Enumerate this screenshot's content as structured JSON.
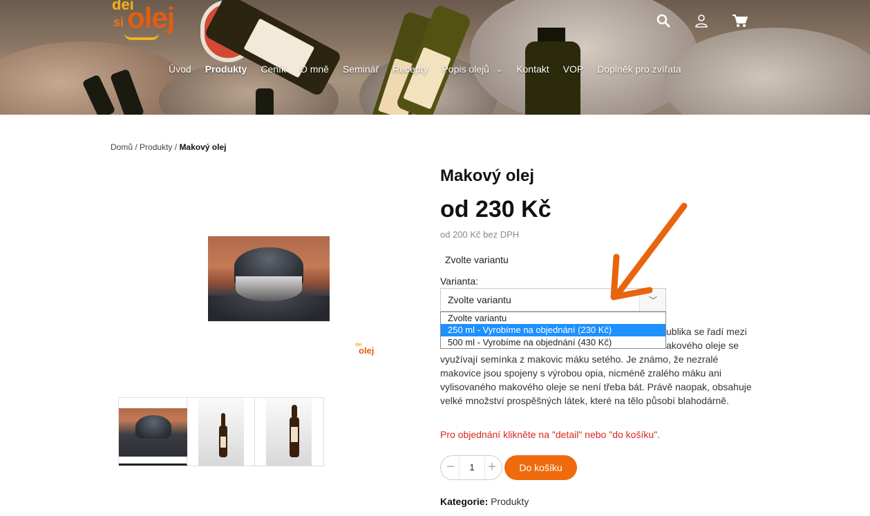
{
  "brand": {
    "logo_text_top": "dei",
    "logo_text_small": "si",
    "logo_text_main": "olej"
  },
  "header": {
    "nav": [
      {
        "label": "Úvod",
        "active": false
      },
      {
        "label": "Produkty",
        "active": true
      },
      {
        "label": "Ceník",
        "active": false
      },
      {
        "label": "O mně",
        "active": false
      },
      {
        "label": "Seminář",
        "active": false
      },
      {
        "label": "Recepty",
        "active": false
      },
      {
        "label": "Popis olejů",
        "active": false,
        "has_dropdown": true
      },
      {
        "label": "Kontakt",
        "active": false
      },
      {
        "label": "VOP",
        "active": false
      },
      {
        "label": "Doplněk pro zvířata",
        "active": false
      }
    ],
    "icons": [
      "search-icon",
      "user-icon",
      "cart-icon"
    ]
  },
  "breadcrumb": {
    "home": "Domů",
    "sep": "/",
    "section": "Produkty",
    "current": "Makový olej"
  },
  "product": {
    "title": "Makový olej",
    "price": "od 230 Kč",
    "price_net": "od 200 Kč bez DPH",
    "choose_variant": "Zvolte variantu",
    "variant_label": "Varianta:",
    "select_value": "Zvolte variantu",
    "options": [
      "Zvolte variantu",
      "250 ml - Vyrobíme na objednání  (230 Kč)",
      "500 ml - Vyrobíme na objednání  (430 Kč)"
    ],
    "selected_option_index": 1,
    "description_line1_tail": "ublika se řadí mezi",
    "description_line2_tail": "akového oleje se",
    "description_rest": "využívají semínka z makovic máku setého. Je známo, že nezralé makovice jsou spojeny s výrobou opia, nicméně zralého máku ani vylisovaného makového oleje se není třeba bát. Právě naopak, obsahuje velké množství prospěšných látek, které na tělo působí blahodárně.",
    "order_note": "Pro objednání klikněte na \"detail\" nebo \"do košíku\".",
    "quantity": "1",
    "cart_button": "Do košíku",
    "category_label": "Kategorie:",
    "category_value": "Produkty"
  },
  "colors": {
    "accent": "#ef6a0d",
    "note_red": "#d9261c",
    "select_highlight": "#1e90ff",
    "annotation_arrow": "#e8650f"
  }
}
